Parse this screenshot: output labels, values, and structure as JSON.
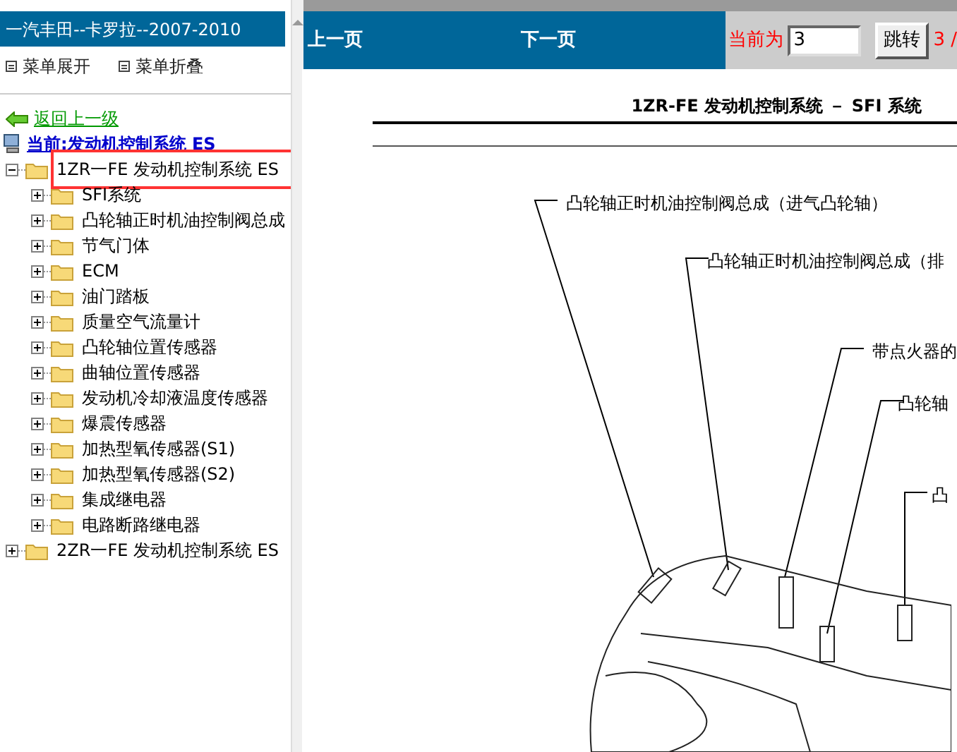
{
  "sidebar": {
    "title": "一汽丰田--卡罗拉--2007-2010",
    "menu": [
      {
        "label": "菜单展开"
      },
      {
        "label": "菜单折叠"
      }
    ],
    "back_link": "返回上一级",
    "tree": {
      "label": "当前:发动机控制系统 ES",
      "children": [
        {
          "label": "1ZR一FE 发动机控制系统 ES",
          "expanded": true,
          "selected": true,
          "children": [
            {
              "label": "SFI系统",
              "expanded": false,
              "selected": false
            },
            {
              "label": "凸轮轴正时机油控制阀总成",
              "expanded": false,
              "selected": false
            },
            {
              "label": "节气门体",
              "expanded": false,
              "selected": false
            },
            {
              "label": "ECM",
              "expanded": false,
              "selected": false
            },
            {
              "label": "油门踏板",
              "expanded": false,
              "selected": false
            },
            {
              "label": "质量空气流量计",
              "expanded": false,
              "selected": false
            },
            {
              "label": "凸轮轴位置传感器",
              "expanded": false,
              "selected": false
            },
            {
              "label": "曲轴位置传感器",
              "expanded": false,
              "selected": false
            },
            {
              "label": "发动机冷却液温度传感器",
              "expanded": false,
              "selected": false
            },
            {
              "label": "爆震传感器",
              "expanded": false,
              "selected": false
            },
            {
              "label": "加热型氧传感器(S1)",
              "expanded": false,
              "selected": false
            },
            {
              "label": "加热型氧传感器(S2)",
              "expanded": false,
              "selected": false
            },
            {
              "label": "集成继电器",
              "expanded": false,
              "selected": false
            },
            {
              "label": "电路断路继电器",
              "expanded": false,
              "selected": false
            }
          ]
        },
        {
          "label": "2ZR一FE 发动机控制系统 ES",
          "expanded": false,
          "selected": false
        }
      ]
    }
  },
  "toolbar": {
    "prev": "上一页",
    "next": "下一页",
    "current_label": "当前为",
    "page_value": "3",
    "jump_button": "跳转",
    "page_total": "3 /"
  },
  "document": {
    "title": "1ZR-FE 发动机控制系统 － SFI 系统",
    "callouts": [
      {
        "text": "凸轮轴正时机油控制阀总成（进气凸轮轴）"
      },
      {
        "text": "凸轮轴正时机油控制阀总成（排"
      },
      {
        "text": "带点火器的"
      },
      {
        "text": "凸轮轴"
      },
      {
        "text": "凸"
      }
    ]
  }
}
